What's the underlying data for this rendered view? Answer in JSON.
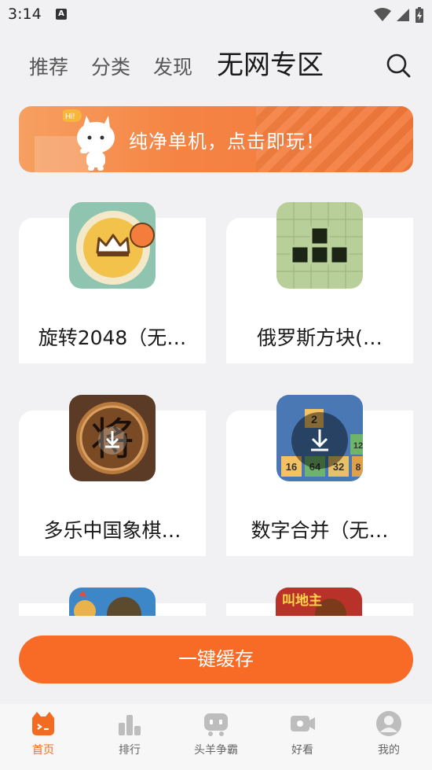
{
  "status_bar": {
    "time": "3:14",
    "notification_glyph": "A"
  },
  "tabs": [
    {
      "label": "推荐",
      "active": false
    },
    {
      "label": "分类",
      "active": false
    },
    {
      "label": "发现",
      "active": false
    },
    {
      "label": "无网专区",
      "active": true
    }
  ],
  "search": {
    "icon": "search-icon"
  },
  "banner": {
    "text": "纯净单机，点击即玩！",
    "mascot_bubble": "Hi!"
  },
  "games": [
    {
      "name": "旋转2048（无…",
      "icon": "crown-icon"
    },
    {
      "name": "俄罗斯方块(…",
      "icon": "tetris-icon"
    },
    {
      "name": "多乐中国象棋…",
      "icon": "chess-jiang-icon",
      "icon_glyph": "将"
    },
    {
      "name": "数字合并（无…",
      "icon": "number-merge-icon",
      "tiles": [
        "2",
        "16",
        "64",
        "32",
        "12",
        "8"
      ]
    },
    {
      "name": "",
      "icon": "game-icon-5"
    },
    {
      "name": "",
      "icon": "game-icon-6",
      "icon_text": "叫地主"
    }
  ],
  "cache_button": {
    "label": "一键缓存"
  },
  "bottom_nav": [
    {
      "label": "首页",
      "icon": "home-icon",
      "active": true
    },
    {
      "label": "排行",
      "icon": "ranking-icon",
      "active": false
    },
    {
      "label": "头羊争霸",
      "icon": "gamepad-icon",
      "active": false
    },
    {
      "label": "好看",
      "icon": "video-icon",
      "active": false
    },
    {
      "label": "我的",
      "icon": "profile-icon",
      "active": false
    }
  ],
  "colors": {
    "accent": "#f76b26",
    "background": "#f1f1f3",
    "card": "#ffffff"
  }
}
